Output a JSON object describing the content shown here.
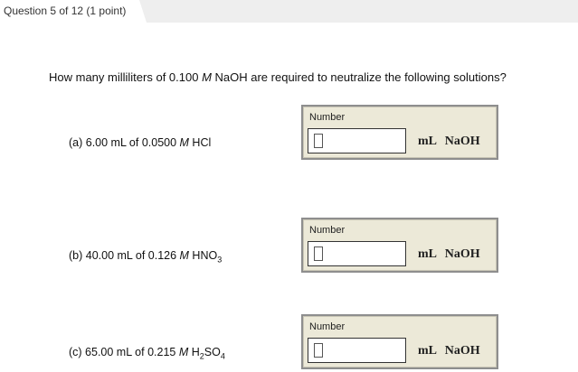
{
  "header": {
    "title": "Question 5 of 12 (1 point)"
  },
  "question": {
    "pre": "How many milliliters of 0.100 ",
    "M": "M",
    "post": " NaOH are required to neutralize the following solutions?"
  },
  "parts": [
    {
      "pre": "(a) 6.00 mL of 0.0500 ",
      "M": "M",
      "formula": " HCl",
      "sub": "",
      "tail": "",
      "label": "Number",
      "unit": "mL  NaOH",
      "value": ""
    },
    {
      "pre": "(b) 40.00 mL of 0.126 ",
      "M": "M",
      "formula": " HNO",
      "sub": "3",
      "tail": "",
      "label": "Number",
      "unit": "mL  NaOH",
      "value": ""
    },
    {
      "pre": "(c) 65.00 mL of 0.215 ",
      "M": "M",
      "formula": " H",
      "sub": "2",
      "tail": "SO",
      "sub2": "4",
      "label": "Number",
      "unit": "mL  NaOH",
      "value": ""
    }
  ]
}
